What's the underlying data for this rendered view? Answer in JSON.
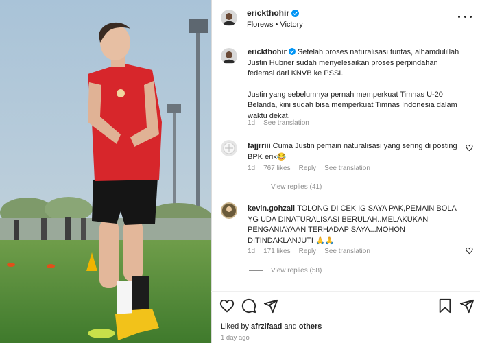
{
  "header": {
    "username": "erickthohir",
    "subtitle_left": "Florews",
    "subtitle_sep": "•",
    "subtitle_right": "Victory"
  },
  "caption": {
    "username": "erickthohir",
    "para1": "Setelah proses naturalisasi tuntas, alhamdulillah Justin Hubner sudah menyelesaikan proses perpindahan federasi dari KNVB ke PSSI.",
    "para2": "Justin yang sebelumnya pernah memperkuat Timnas U-20 Belanda, kini sudah bisa memperkuat Timnas Indonesia dalam waktu dekat.",
    "time": "1d",
    "translate": "See translation"
  },
  "comments": [
    {
      "username": "fajjrriii",
      "text": "Cuma Justin pemain naturalisasi yang sering di posting BPK erik😂",
      "time": "1d",
      "likes": "767 likes",
      "reply": "Reply",
      "translate": "See translation",
      "view_replies": "View replies (41)"
    },
    {
      "username": "kevin.gohzali",
      "text": "TOLONG DI CEK IG SAYA PAK,PEMAIN BOLA YG UDA DINATURALISASI BERULAH..MELAKUKAN PENGANIAYAAN TERHADAP SAYA...MOHON DITINDAKLANJUTI 🙏🙏",
      "time": "1d",
      "likes": "171 likes",
      "reply": "Reply",
      "translate": "See translation",
      "view_replies": "View replies (58)"
    }
  ],
  "footer": {
    "liked_prefix": "Liked by",
    "liked_user": "afrzlfaad",
    "liked_and": "and",
    "liked_others": "others",
    "time_ago": "1 day ago"
  },
  "icons": {
    "verified": "verified-badge-icon",
    "like": "heart-icon",
    "comment": "comment-icon",
    "share": "send-icon",
    "save": "bookmark-icon",
    "more": "more-options-icon"
  },
  "colors": {
    "verified_blue": "#0095f6",
    "muted_text": "#8e8e8e",
    "jersey_red": "#d7262b",
    "pitch_green": "#4f8a36"
  }
}
